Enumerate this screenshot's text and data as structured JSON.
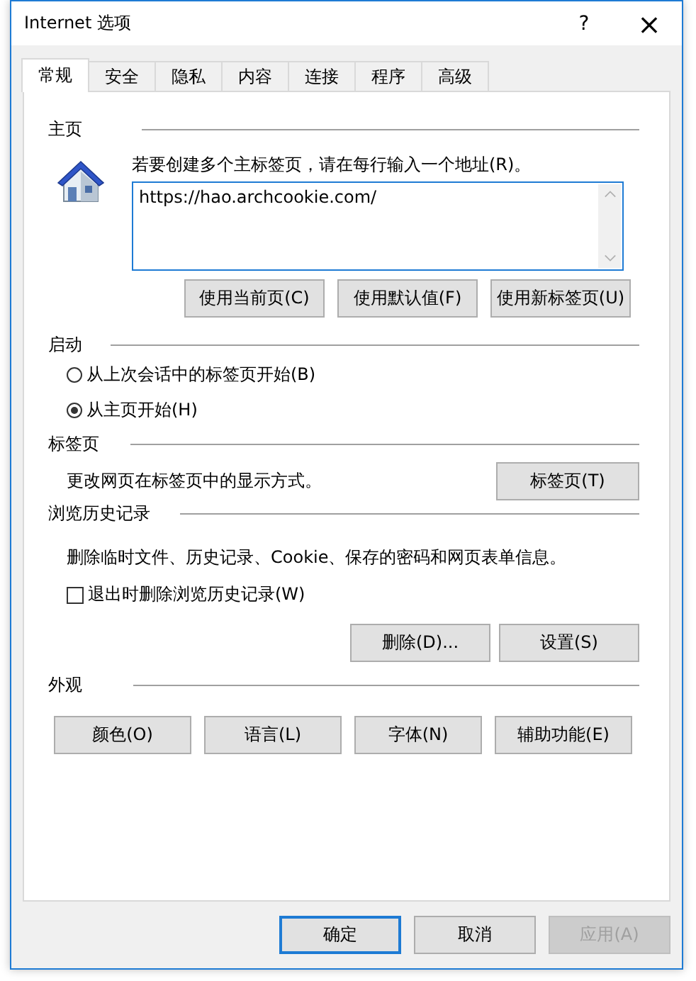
{
  "window": {
    "title": "Internet 选项",
    "help": "?",
    "close": "×"
  },
  "tabs": [
    {
      "label": "常规",
      "selected": true
    },
    {
      "label": "安全",
      "selected": false
    },
    {
      "label": "隐私",
      "selected": false
    },
    {
      "label": "内容",
      "selected": false
    },
    {
      "label": "连接",
      "selected": false
    },
    {
      "label": "程序",
      "selected": false
    },
    {
      "label": "高级",
      "selected": false
    }
  ],
  "home": {
    "heading": "主页",
    "hint": "若要创建多个主标签页，请在每行输入一个地址(R)。",
    "value": "https://hao.archcookie.com/",
    "buttons": [
      "使用当前页(C)",
      "使用默认值(F)",
      "使用新标签页(U)"
    ]
  },
  "startup": {
    "heading": "启动",
    "options": [
      {
        "label": "从上次会话中的标签页开始(B)",
        "selected": false
      },
      {
        "label": "从主页开始(H)",
        "selected": true
      }
    ]
  },
  "tabs_section": {
    "heading": "标签页",
    "text": "更改网页在标签页中的显示方式。",
    "button": "标签页(T)"
  },
  "history": {
    "heading": "浏览历史记录",
    "text": "删除临时文件、历史记录、Cookie、保存的密码和网页表单信息。",
    "checkbox": {
      "label": "退出时删除浏览历史记录(W)",
      "checked": false
    },
    "buttons": [
      "删除(D)...",
      "设置(S)"
    ]
  },
  "appearance": {
    "heading": "外观",
    "buttons": [
      "颜色(O)",
      "语言(L)",
      "字体(N)",
      "辅助功能(E)"
    ]
  },
  "footer": [
    {
      "label": "确定",
      "kind": "default",
      "disabled": false
    },
    {
      "label": "取消",
      "kind": "normal",
      "disabled": false
    },
    {
      "label": "应用(A)",
      "kind": "normal",
      "disabled": true
    }
  ]
}
